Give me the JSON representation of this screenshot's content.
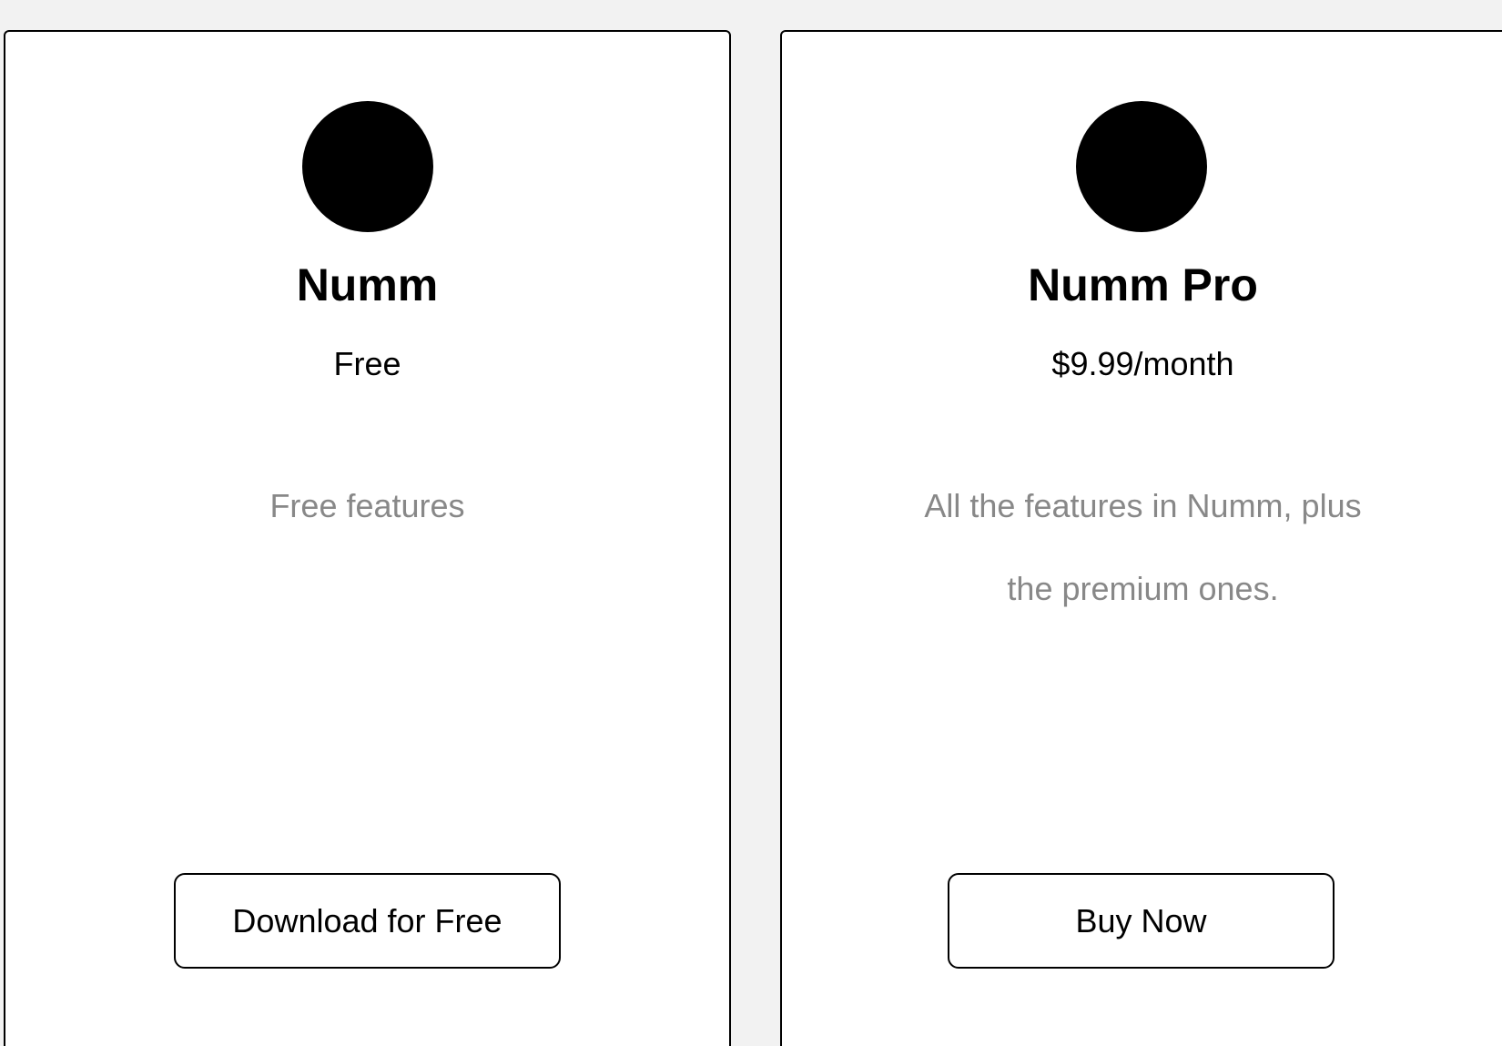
{
  "plans": [
    {
      "name": "Numm",
      "price": "Free",
      "description_lines": [
        "Free features"
      ],
      "cta_label": "Download for Free"
    },
    {
      "name": "Numm Pro",
      "price": "$9.99/month",
      "description_lines": [
        "All the features in Numm, plus",
        "the premium ones."
      ],
      "cta_label": "Buy Now"
    }
  ],
  "colors": {
    "background": "#f2f2f2",
    "card": "#ffffff",
    "border": "#000000",
    "description_text": "#888888"
  }
}
